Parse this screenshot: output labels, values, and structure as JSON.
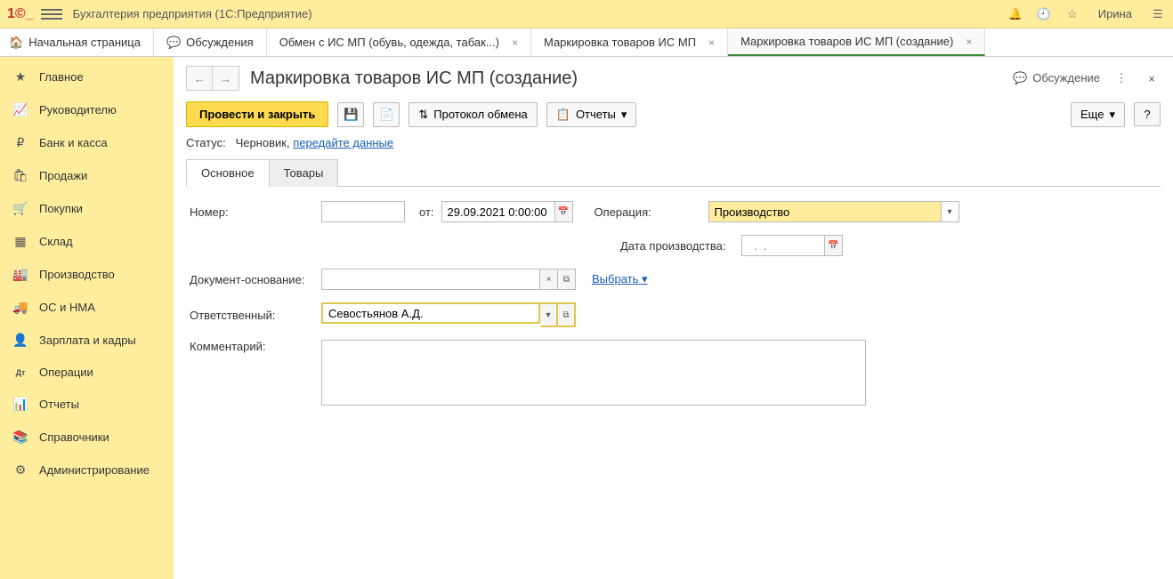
{
  "titlebar": {
    "app_title": "Бухгалтерия предприятия  (1С:Предприятие)",
    "user": "Ирина"
  },
  "tabs": {
    "home": "Начальная страница",
    "t1": "Обсуждения",
    "t2": "Обмен с ИС МП (обувь, одежда, табак...)",
    "t3": "Маркировка товаров ИС МП",
    "t4": "Маркировка товаров ИС МП (создание)"
  },
  "sidebar": {
    "items": [
      {
        "icon": "★",
        "label": "Главное"
      },
      {
        "icon": "📈",
        "label": "Руководителю"
      },
      {
        "icon": "₽",
        "label": "Банк и касса"
      },
      {
        "icon": "🛍",
        "label": "Продажи"
      },
      {
        "icon": "🛒",
        "label": "Покупки"
      },
      {
        "icon": "▦",
        "label": "Склад"
      },
      {
        "icon": "🏭",
        "label": "Производство"
      },
      {
        "icon": "🚚",
        "label": "ОС и НМА"
      },
      {
        "icon": "👤",
        "label": "Зарплата и кадры"
      },
      {
        "icon": "Дт",
        "label": "Операции"
      },
      {
        "icon": "📊",
        "label": "Отчеты"
      },
      {
        "icon": "📚",
        "label": "Справочники"
      },
      {
        "icon": "⚙",
        "label": "Администрирование"
      }
    ]
  },
  "page": {
    "title": "Маркировка товаров ИС МП (создание)",
    "discussion": "Обсуждение"
  },
  "toolbar": {
    "post_close": "Провести и закрыть",
    "protocol": "Протокол обмена",
    "reports": "Отчеты",
    "more": "Еще",
    "help": "?"
  },
  "status": {
    "label": "Статус:",
    "value": "Черновик,",
    "link": "передайте данные"
  },
  "inner_tabs": {
    "main": "Основное",
    "goods": "Товары"
  },
  "form": {
    "number_label": "Номер:",
    "number_value": "",
    "from_label": "от:",
    "date_value": "29.09.2021 0:00:00",
    "operation_label": "Операция:",
    "operation_value": "Производство",
    "prod_date_label": "Дата производства:",
    "prod_date_value": "",
    "doc_base_label": "Документ-основание:",
    "doc_base_value": "",
    "select_link": "Выбрать",
    "responsible_label": "Ответственный:",
    "responsible_value": "Севостьянов А.Д.",
    "comment_label": "Комментарий:",
    "comment_value": ""
  }
}
